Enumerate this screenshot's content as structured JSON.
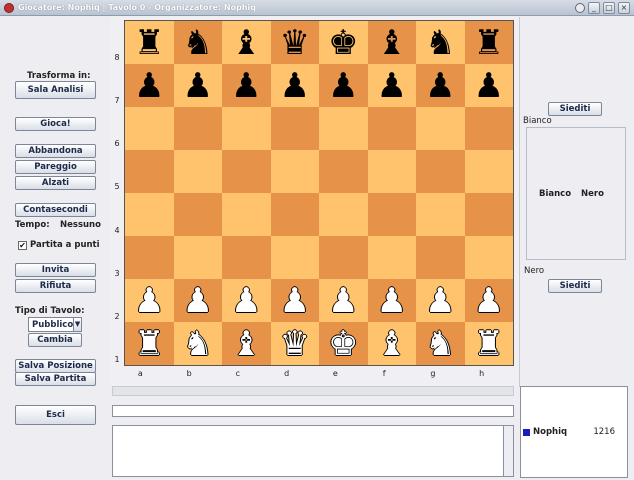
{
  "window": {
    "title": "Giocatore: Nophiq | Tavolo 0 - Organizzatore: Nophiq",
    "controls": [
      "_",
      "□",
      "×"
    ]
  },
  "left": {
    "transform_label": "Trasforma in:",
    "analysis_button": "Sala Analisi",
    "play_button": "Gioca!",
    "resign_button": "Abbandona",
    "draw_button": "Pareggio",
    "standup_button": "Alzati",
    "clock_button": "Contasecondi",
    "time_label": "Tempo:",
    "time_value": "Nessuno",
    "rated_label": "Partita a punti",
    "rated_checked": "✔",
    "invite_button": "Invita",
    "refuse_button": "Rifiuta",
    "table_type_label": "Tipo di Tavolo:",
    "table_type_value": "Pubblico",
    "change_button": "Cambia",
    "save_position_button": "Salva Posizione",
    "save_game_button": "Salva Partita",
    "exit_button": "Esci"
  },
  "board": {
    "ranks": [
      "8",
      "7",
      "6",
      "5",
      "4",
      "3",
      "2",
      "1"
    ],
    "files": [
      "a",
      "b",
      "c",
      "d",
      "e",
      "f",
      "g",
      "h"
    ],
    "rows": [
      [
        "♜",
        "♞",
        "♝",
        "♛",
        "♚",
        "♝",
        "♞",
        "♜"
      ],
      [
        "♟",
        "♟",
        "♟",
        "♟",
        "♟",
        "♟",
        "♟",
        "♟"
      ],
      [
        "",
        "",
        "",
        "",
        "",
        "",
        "",
        ""
      ],
      [
        "",
        "",
        "",
        "",
        "",
        "",
        "",
        ""
      ],
      [
        "",
        "",
        "",
        "",
        "",
        "",
        "",
        ""
      ],
      [
        "",
        "",
        "",
        "",
        "",
        "",
        "",
        ""
      ],
      [
        "♟",
        "♟",
        "♟",
        "♟",
        "♟",
        "♟",
        "♟",
        "♟"
      ],
      [
        "♜",
        "♞",
        "♝",
        "♛",
        "♚",
        "♝",
        "♞",
        "♜"
      ]
    ],
    "row_colors": [
      "black",
      "black",
      "",
      "",
      "",
      "",
      "white",
      "white"
    ],
    "colors": {
      "light": "#ffc36d",
      "dark": "#e69349"
    }
  },
  "right": {
    "sit_top_button": "Siediti",
    "white_label": "Bianco",
    "white_col": "Bianco",
    "black_col": "Nero",
    "black_label": "Nero",
    "sit_bottom_button": "Siediti"
  },
  "users": [
    {
      "name": "Nophiq",
      "rating": "1216",
      "color": "#1b1bbf"
    }
  ]
}
